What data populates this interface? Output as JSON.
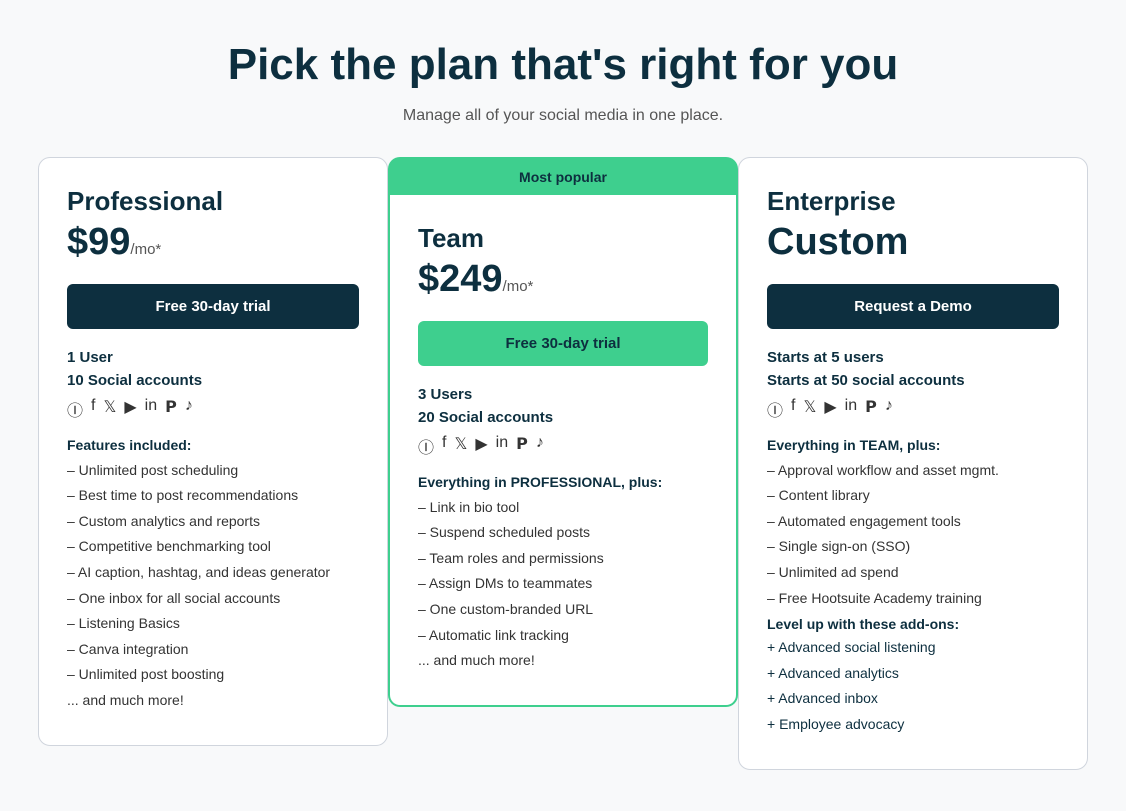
{
  "page": {
    "title": "Pick the plan that's right for you",
    "subtitle": "Manage all of your social media in one place."
  },
  "plans": [
    {
      "id": "professional",
      "name": "Professional",
      "price_amount": "$99",
      "price_period": "/mo*",
      "cta_label": "Free 30-day trial",
      "cta_style": "dark",
      "users": "1 User",
      "accounts": "10 Social accounts",
      "social_icons": [
        "ⓘ",
        "f",
        "𝕏",
        "▶",
        "in",
        "𝗽",
        "♪"
      ],
      "features_label": "Features included:",
      "features": [
        "– Unlimited post scheduling",
        "– Best time to post recommendations",
        "– Custom analytics and reports",
        "– Competitive benchmarking tool",
        "– AI caption, hashtag, and ideas generator",
        "– One inbox for all social accounts",
        "– Listening Basics",
        "– Canva integration",
        "– Unlimited post boosting",
        "... and much more!"
      ]
    },
    {
      "id": "team",
      "name": "Team",
      "price_amount": "$249",
      "price_period": "/mo*",
      "cta_label": "Free 30-day trial",
      "cta_style": "green",
      "badge": "Most popular",
      "users": "3 Users",
      "accounts": "20 Social accounts",
      "social_icons": [
        "ⓘ",
        "f",
        "𝕏",
        "▶",
        "in",
        "𝗽",
        "♪"
      ],
      "features_label": "Everything in PROFESSIONAL, plus:",
      "features": [
        "– Link in bio tool",
        "– Suspend scheduled posts",
        "– Team roles and permissions",
        "– Assign DMs to teammates",
        "– One custom-branded URL",
        "– Automatic link tracking",
        "... and much more!"
      ]
    },
    {
      "id": "enterprise",
      "name": "Enterprise",
      "price_amount": "Custom",
      "price_period": "",
      "cta_label": "Request a Demo",
      "cta_style": "dark",
      "users": "Starts at 5 users",
      "accounts": "Starts at 50 social accounts",
      "social_icons": [
        "ⓘ",
        "f",
        "𝕏",
        "▶",
        "in",
        "𝗽",
        "♪"
      ],
      "features_label": "Everything in TEAM, plus:",
      "features": [
        "– Approval workflow and asset mgmt.",
        "– Content library",
        "– Automated engagement tools",
        "– Single sign-on (SSO)",
        "– Unlimited ad spend",
        "– Free Hootsuite Academy training"
      ],
      "addons_label": "Level up with these add-ons:",
      "addons": [
        "+ Advanced social listening",
        "+ Advanced analytics",
        "+ Advanced inbox",
        "+ Employee advocacy"
      ]
    }
  ]
}
